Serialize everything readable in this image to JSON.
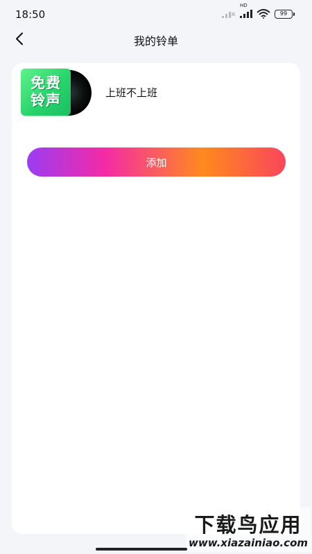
{
  "status_bar": {
    "time": "18:50",
    "network_label": "HD",
    "battery": "99"
  },
  "header": {
    "title": "我的铃单",
    "back_icon": "chevron-left-icon"
  },
  "ringtones": [
    {
      "cover_line1": "免费",
      "cover_line2": "铃声",
      "name": "上班不上班"
    }
  ],
  "add_button_label": "添加",
  "colors": {
    "background": "#f4f5f8",
    "card": "#ffffff",
    "gradient": [
      "#9b3df2",
      "#f42aa6",
      "#ff8a1d",
      "#f9455b"
    ],
    "cover_green": "#29d46c"
  },
  "watermark": {
    "title": "下载鸟应用",
    "url": "www.xiazainiao.com"
  }
}
